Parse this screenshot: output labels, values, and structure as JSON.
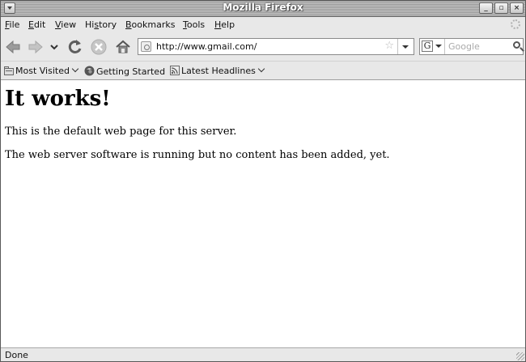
{
  "window": {
    "title": "Mozilla Firefox"
  },
  "menu": [
    {
      "label": "File",
      "key": "F",
      "rest": "ile"
    },
    {
      "label": "Edit",
      "key": "E",
      "rest": "dit"
    },
    {
      "label": "View",
      "key": "V",
      "rest": "iew"
    },
    {
      "label": "History",
      "key": "",
      "rest": "History",
      "pre": "Hi",
      "u": "s",
      "post": "tory"
    },
    {
      "label": "Bookmarks",
      "key": "B",
      "rest": "ookmarks"
    },
    {
      "label": "Tools",
      "key": "T",
      "rest": "ools"
    },
    {
      "label": "Help",
      "key": "H",
      "rest": "elp"
    }
  ],
  "nav": {
    "back_icon": "back-arrow-icon",
    "forward_icon": "forward-arrow-icon",
    "history_icon": "history-dropdown-icon",
    "reload_icon": "reload-icon",
    "stop_icon": "stop-icon",
    "home_icon": "home-icon"
  },
  "address": {
    "url": "http://www.gmail.com/"
  },
  "search": {
    "placeholder": "Google",
    "engine_letter": "G"
  },
  "bookmarks": [
    {
      "label": "Most Visited",
      "icon": "folder-icon",
      "dropdown": true
    },
    {
      "label": "Getting Started",
      "icon": "firefox-icon",
      "dropdown": false
    },
    {
      "label": "Latest Headlines",
      "icon": "rss-feed-icon",
      "dropdown": true
    }
  ],
  "page": {
    "heading": "It works!",
    "para1": "This is the default web page for this server.",
    "para2": "The web server software is running but no content has been added, yet."
  },
  "status": {
    "text": "Done"
  }
}
